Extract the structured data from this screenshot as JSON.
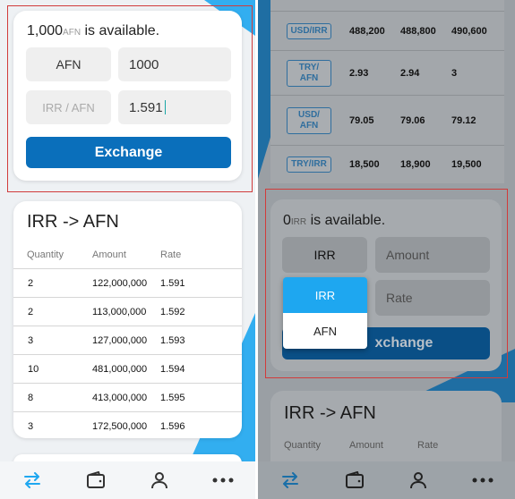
{
  "left": {
    "exchange": {
      "balance_amount": "1,000",
      "balance_currency": "AFN",
      "available_text": " is available.",
      "currency_value": "AFN",
      "amount_value": "1000",
      "pair_placeholder": "IRR / AFN",
      "rate_value": "1.591",
      "button_label": "Exchange"
    },
    "orderbook": {
      "title": "IRR -> AFN",
      "columns": [
        "Quantity",
        "Amount",
        "Rate"
      ],
      "rows": [
        {
          "quantity": "2",
          "amount": "122,000,000",
          "rate": "1.591"
        },
        {
          "quantity": "2",
          "amount": "113,000,000",
          "rate": "1.592"
        },
        {
          "quantity": "3",
          "amount": "127,000,000",
          "rate": "1.593"
        },
        {
          "quantity": "10",
          "amount": "481,000,000",
          "rate": "1.594"
        },
        {
          "quantity": "8",
          "amount": "413,000,000",
          "rate": "1.595"
        },
        {
          "quantity": "3",
          "amount": "172,500,000",
          "rate": "1.596"
        }
      ]
    }
  },
  "right": {
    "rates": [
      {
        "pair": "USD/IRR",
        "v1": "488,200",
        "v2": "488,800",
        "v3": "490,600"
      },
      {
        "pair": "TRY/\nAFN",
        "v1": "2.93",
        "v2": "2.94",
        "v3": "3"
      },
      {
        "pair": "USD/\nAFN",
        "v1": "79.05",
        "v2": "79.06",
        "v3": "79.12"
      },
      {
        "pair": "TRY/IRR",
        "v1": "18,500",
        "v2": "18,900",
        "v3": "19,500"
      }
    ],
    "exchange": {
      "balance_amount": "0",
      "balance_currency": "IRR",
      "available_text": " is available.",
      "currency_value": "IRR",
      "amount_placeholder": "Amount",
      "rate_placeholder": "Rate",
      "button_label_visible": "xchange"
    },
    "dropdown": {
      "options": [
        "IRR",
        "AFN"
      ]
    },
    "orderbook": {
      "title": "IRR -> AFN",
      "columns": [
        "Quantity",
        "Amount",
        "Rate"
      ]
    }
  },
  "nav": {
    "icons": [
      "swap-icon",
      "wallet-icon",
      "user-icon",
      "more-icon"
    ]
  },
  "colors": {
    "accent": "#0a6fbb",
    "dropdown_selected": "#1ea7f0",
    "highlight_border": "#d13b3b"
  }
}
